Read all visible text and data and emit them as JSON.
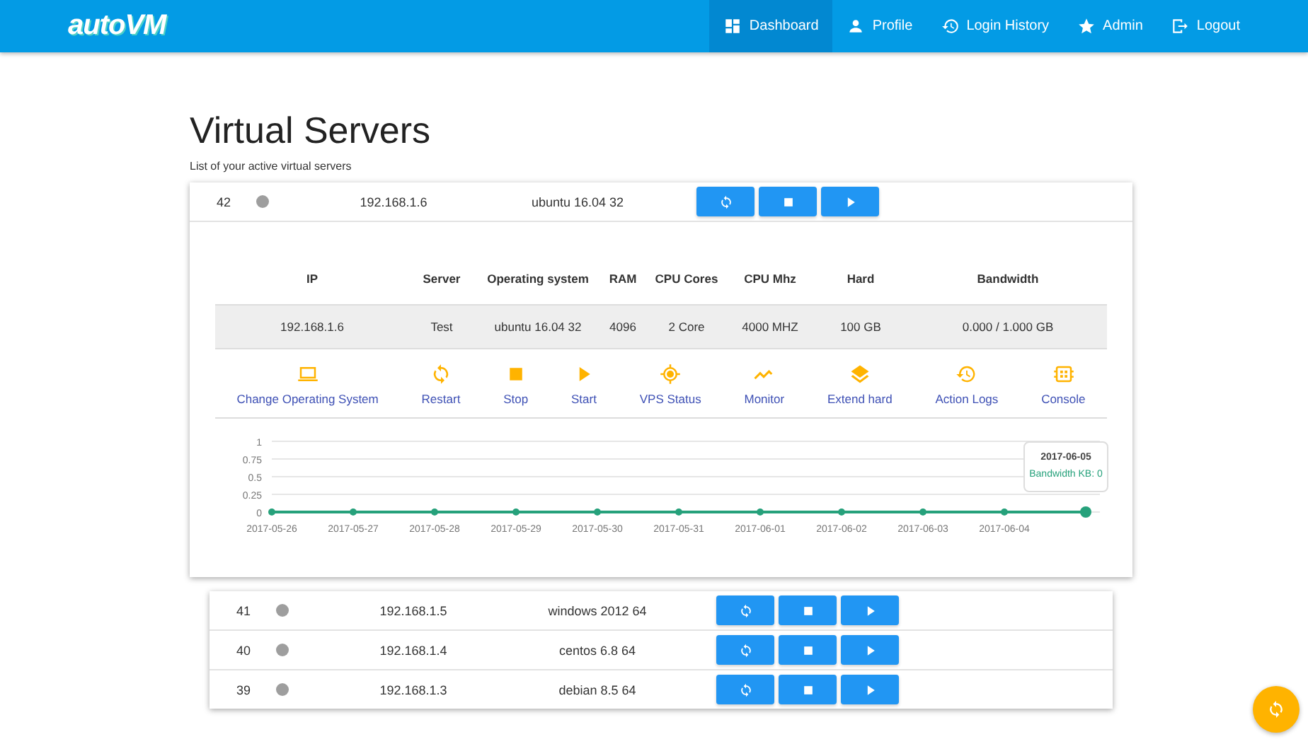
{
  "navbar": {
    "logo": "autoVM",
    "items": [
      {
        "label": "Dashboard",
        "selected": true
      },
      {
        "label": "Profile",
        "selected": false
      },
      {
        "label": "Login History",
        "selected": false
      },
      {
        "label": "Admin",
        "selected": false
      },
      {
        "label": "Logout",
        "selected": false
      }
    ]
  },
  "page": {
    "title": "Virtual Servers",
    "subtitle": "List of your active virtual servers"
  },
  "servers": [
    {
      "id": "42",
      "color": "#9e9e9e",
      "ip": "192.168.1.6",
      "os": "ubuntu 16.04 32",
      "expanded": true,
      "details": {
        "columns": [
          "IP",
          "Server",
          "Operating system",
          "RAM",
          "CPU Cores",
          "CPU Mhz",
          "Hard",
          "Bandwidth"
        ],
        "values": [
          "192.168.1.6",
          "Test",
          "ubuntu 16.04 32",
          "4096",
          "2 Core",
          "4000 MHZ",
          "100 GB",
          "0.000 / 1.000 GB"
        ],
        "actions": [
          {
            "label": "Change Operating System"
          },
          {
            "label": "Restart"
          },
          {
            "label": "Stop"
          },
          {
            "label": "Start"
          },
          {
            "label": "VPS Status"
          },
          {
            "label": "Monitor"
          },
          {
            "label": "Extend hard"
          },
          {
            "label": "Action Logs"
          },
          {
            "label": "Console"
          }
        ],
        "chart_data": {
          "type": "line",
          "categories": [
            "2017-05-26",
            "2017-05-27",
            "2017-05-28",
            "2017-05-29",
            "2017-05-30",
            "2017-05-31",
            "2017-06-01",
            "2017-06-02",
            "2017-06-03",
            "2017-06-04",
            null
          ],
          "series": [
            {
              "color": "#26a17b",
              "marker": true,
              "values": [
                0,
                0,
                0,
                0,
                0,
                0,
                0,
                0,
                0,
                0,
                0
              ]
            }
          ],
          "grid": true,
          "ylim": [
            0,
            1
          ],
          "yticks": [
            0,
            {
              "value": 0.25,
              "label": "0.25"
            },
            {
              "value": 0.5,
              "label": "0.5"
            },
            {
              "value": 0.75,
              "label": "0.75"
            },
            1
          ]
        },
        "chart_tooltip": {
          "title": "2017-06-05",
          "text": "Bandwidth KB: 0"
        }
      }
    },
    {
      "id": "41",
      "color": "#9e9e9e",
      "ip": "192.168.1.5",
      "os": "windows 2012 64",
      "expanded": false
    },
    {
      "id": "40",
      "color": "#9e9e9e",
      "ip": "192.168.1.4",
      "os": "centos 6.8 64",
      "expanded": false
    },
    {
      "id": "39",
      "color": "#9e9e9e",
      "ip": "192.168.1.3",
      "os": "debian 8.5 64",
      "expanded": false
    }
  ],
  "fab": {
    "kind": "refresh"
  }
}
